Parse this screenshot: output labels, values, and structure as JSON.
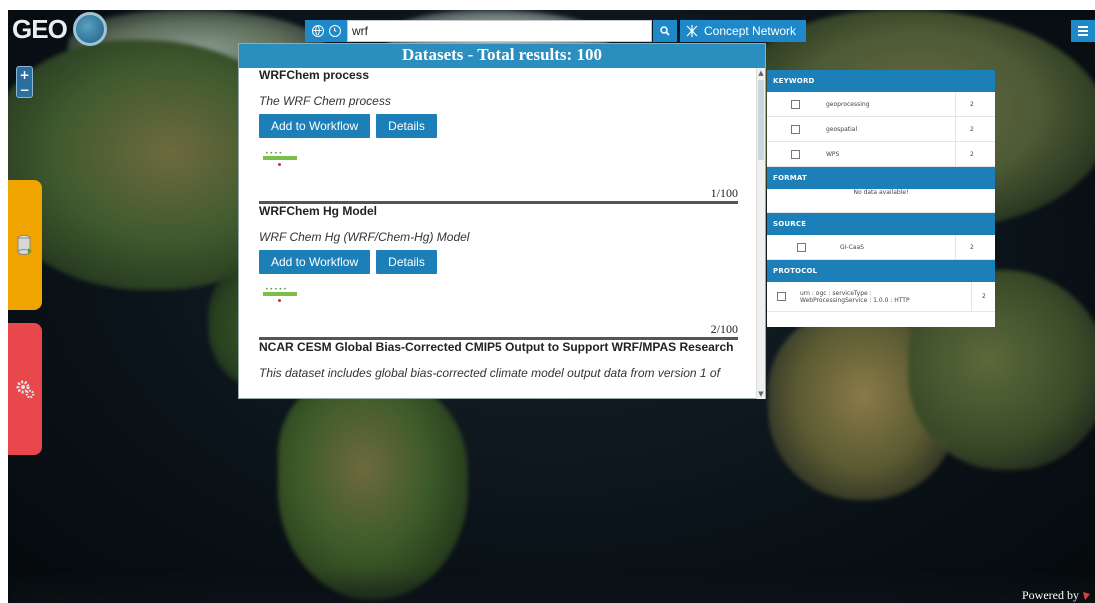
{
  "search": {
    "query": "wrf"
  },
  "toolbar": {
    "concept_network_label": "Concept Network"
  },
  "logo": {
    "text": "GEO"
  },
  "datasets": {
    "header": "Datasets - Total results: 100",
    "items": [
      {
        "title": "WRFChem process",
        "description": "The WRF Chem process",
        "add_label": "Add to Workflow",
        "details_label": "Details",
        "counter": "1/100"
      },
      {
        "title": "WRFChem Hg Model",
        "description": "WRF Chem Hg (WRF/Chem-Hg) Model",
        "add_label": "Add to Workflow",
        "details_label": "Details",
        "counter": "2/100"
      },
      {
        "title": "NCAR CESM Global Bias-Corrected CMIP5 Output to Support WRF/MPAS Research",
        "description": "This dataset includes global bias-corrected climate model output data from version 1 of"
      }
    ]
  },
  "facets": {
    "keyword": {
      "title": "KEYWORD",
      "rows": [
        {
          "label": "geoprocessing",
          "count": "2"
        },
        {
          "label": "geospatial",
          "count": "2"
        },
        {
          "label": "WPS",
          "count": "2"
        }
      ]
    },
    "format": {
      "title": "FORMAT",
      "empty": "No data available!"
    },
    "source": {
      "title": "SOURCE",
      "rows": [
        {
          "label": "GI-CaaS",
          "count": "2"
        }
      ]
    },
    "protocol": {
      "title": "PROTOCOL",
      "rows": [
        {
          "label_line1": "urn : ogc : serviceType :",
          "label_line2": "WebProcessingService : 1.0.0 : HTTP",
          "count": "2"
        }
      ]
    }
  },
  "footer": {
    "powered_by": "Powered by"
  },
  "colors": {
    "accent": "#1c7fb7",
    "header": "#2a8fbe",
    "orange_tab": "#f0a400",
    "red_tab": "#e8474b"
  }
}
